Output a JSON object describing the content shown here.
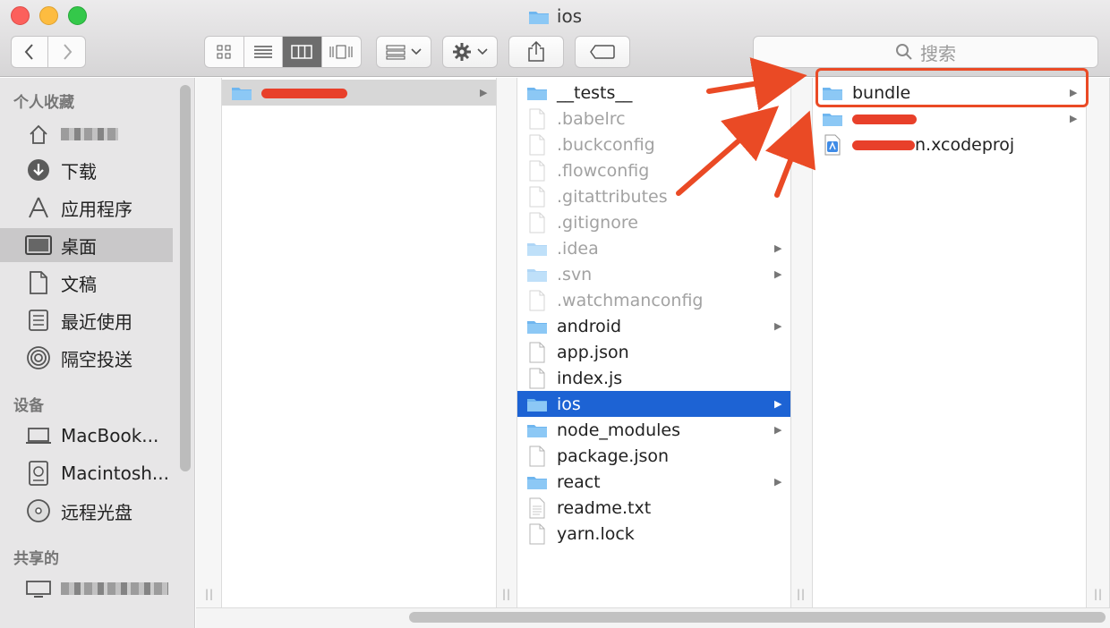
{
  "window": {
    "title": "ios"
  },
  "toolbar": {
    "search_placeholder": "搜索",
    "back_icon": "chevron-left-icon",
    "forward_icon": "chevron-right-icon"
  },
  "sidebar": {
    "favorites_header": "个人收藏",
    "favorites": [
      {
        "label": "",
        "icon": "home-icon",
        "redacted": true
      },
      {
        "label": "下载",
        "icon": "download-icon"
      },
      {
        "label": "应用程序",
        "icon": "applications-icon"
      },
      {
        "label": "桌面",
        "icon": "desktop-icon",
        "selected": true
      },
      {
        "label": "文稿",
        "icon": "documents-icon"
      },
      {
        "label": "最近使用",
        "icon": "recents-icon"
      },
      {
        "label": "隔空投送",
        "icon": "airdrop-icon"
      }
    ],
    "devices_header": "设备",
    "devices": [
      {
        "label": "MacBook...",
        "icon": "laptop-icon"
      },
      {
        "label": "Macintosh...",
        "icon": "harddisk-icon"
      },
      {
        "label": "远程光盘",
        "icon": "disc-icon"
      }
    ],
    "shared_header": "共享的",
    "shared": [
      {
        "label": "",
        "icon": "display-icon",
        "redacted": true
      }
    ]
  },
  "columns": {
    "col1": [
      {
        "label": "",
        "type": "folder",
        "redacted": true,
        "has_children": true
      }
    ],
    "col2": [
      {
        "label": "__tests__",
        "type": "folder",
        "dim": false,
        "has_children": true
      },
      {
        "label": ".babelrc",
        "type": "file",
        "dim": true
      },
      {
        "label": ".buckconfig",
        "type": "file",
        "dim": true
      },
      {
        "label": ".flowconfig",
        "type": "file",
        "dim": true
      },
      {
        "label": ".gitattributes",
        "type": "file",
        "dim": true
      },
      {
        "label": ".gitignore",
        "type": "file",
        "dim": true
      },
      {
        "label": ".idea",
        "type": "folder",
        "dim": true,
        "has_children": true
      },
      {
        "label": ".svn",
        "type": "folder",
        "dim": true,
        "has_children": true
      },
      {
        "label": ".watchmanconfig",
        "type": "file",
        "dim": true
      },
      {
        "label": "android",
        "type": "folder",
        "dim": false,
        "has_children": true
      },
      {
        "label": "app.json",
        "type": "file",
        "dim": false
      },
      {
        "label": "index.js",
        "type": "file",
        "dim": false
      },
      {
        "label": "ios",
        "type": "folder",
        "dim": false,
        "has_children": true,
        "selected": true
      },
      {
        "label": "node_modules",
        "type": "folder",
        "dim": false,
        "has_children": true
      },
      {
        "label": "package.json",
        "type": "file",
        "dim": false
      },
      {
        "label": "react",
        "type": "folder",
        "dim": false,
        "has_children": true
      },
      {
        "label": "readme.txt",
        "type": "textfile",
        "dim": false
      },
      {
        "label": "yarn.lock",
        "type": "file",
        "dim": false
      }
    ],
    "col3": [
      {
        "label": "bundle",
        "type": "folder",
        "has_children": true,
        "highlighted": true
      },
      {
        "label": "",
        "type": "folder",
        "has_children": true,
        "redacted": true
      },
      {
        "label": "n.xcodeproj",
        "type": "xcodeproj",
        "redacted_prefix": true
      }
    ]
  },
  "colors": {
    "selection": "#1d63d4",
    "annotation": "#ea4a25",
    "folder": "#6fb6ef"
  }
}
